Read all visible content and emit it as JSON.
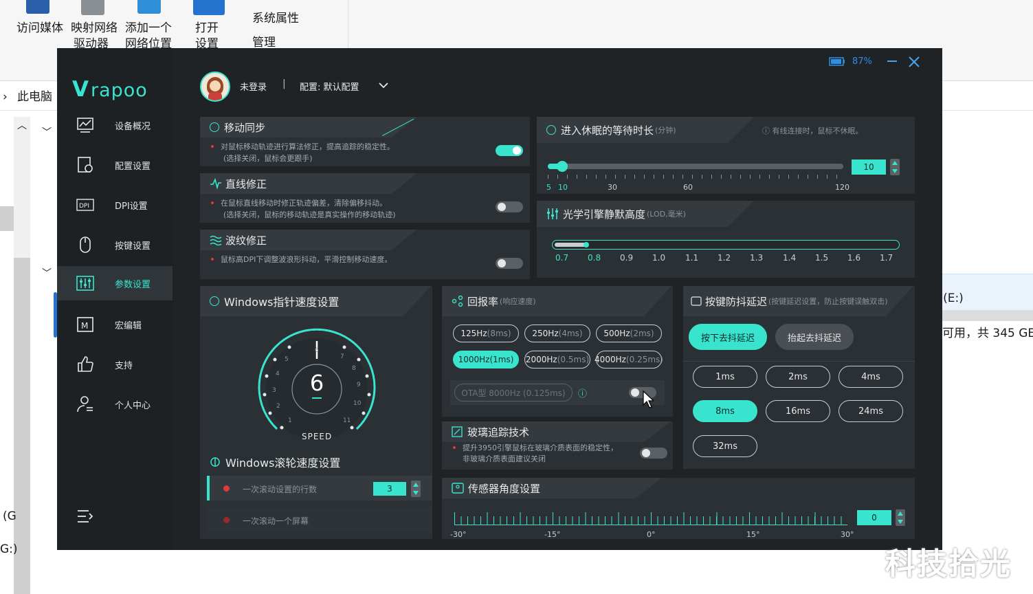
{
  "explorer": {
    "ribbon": [
      "访问媒体",
      "映射网络",
      "驱动器",
      "添加一个",
      "网络位置",
      "打开",
      "设置",
      "系统属性",
      "管理"
    ],
    "address": "此电脑",
    "drive_label": "t (E:)",
    "drive_space": "可用，共 345 GE",
    "left_labels": [
      "(G",
      "G:)"
    ]
  },
  "app": {
    "logo": "rapoo",
    "battery": "87%",
    "user": {
      "name": "未登录",
      "config": "配置: 默认配置"
    },
    "nav": [
      {
        "label": "设备概况",
        "icon": "device-overview-icon"
      },
      {
        "label": "配置设置",
        "icon": "config-icon"
      },
      {
        "label": "DPI设置",
        "icon": "dpi-icon"
      },
      {
        "label": "按键设置",
        "icon": "mouse-icon"
      },
      {
        "label": "参数设置",
        "icon": "sliders-icon",
        "active": true
      },
      {
        "label": "宏编辑",
        "icon": "macro-icon"
      },
      {
        "label": "支持",
        "icon": "thumbs-up-icon"
      },
      {
        "label": "个人中心",
        "icon": "user-icon"
      }
    ],
    "motion_sync": {
      "title": "移动同步",
      "desc1": "对鼠标移动轨迹进行算法修正，提高追踪的稳定性。",
      "desc2": "(选择关闭，鼠标会更跟手)",
      "on": true
    },
    "angle_snap": {
      "title": "直线修正",
      "desc1": "在鼠标直线移动时修正轨迹偏差，清除偏移抖动。",
      "desc2": "(选择关闭，鼠标的移动轨迹是真实操作的移动轨迹)",
      "on": false
    },
    "ripple": {
      "title": "波纹修正",
      "desc1": "鼠标高DPI下调整波浪形抖动，平滑控制移动速度。",
      "on": false
    },
    "sleep": {
      "title": "进入休眠的等待时长",
      "unit": "(分钟)",
      "note": "有线连接时，鼠标不休眠。",
      "value": "10",
      "ticks": [
        "5",
        "10",
        "30",
        "60",
        "120"
      ],
      "level": 0.1
    },
    "lod": {
      "title": "光学引擎静默高度",
      "unit": "(LOD,毫米)",
      "ticks": [
        "0.7",
        "0.8",
        "0.9",
        "1.0",
        "1.1",
        "1.2",
        "1.3",
        "1.4",
        "1.5",
        "1.6",
        "1.7"
      ],
      "selected": "0.8"
    },
    "pointer": {
      "title": "Windows指针速度设置",
      "value": "6",
      "label": "SPEED",
      "dial": [
        "1",
        "2",
        "3",
        "4",
        "5",
        "6",
        "7",
        "8",
        "9",
        "10",
        "11"
      ]
    },
    "scroll": {
      "title": "Windows滚轮速度设置",
      "row1": "一次滚动设置的行数",
      "row1_value": "3",
      "row2": "一次滚动一个屏幕"
    },
    "polling": {
      "title": "回报率",
      "unit": "(响应速度)",
      "rates": [
        {
          "hz": "125Hz",
          "ms": "(8ms)"
        },
        {
          "hz": "250Hz",
          "ms": "(4ms)"
        },
        {
          "hz": "500Hz",
          "ms": "(2ms)"
        },
        {
          "hz": "1000Hz",
          "ms": "(1ms)",
          "on": true
        },
        {
          "hz": "2000Hz",
          "ms": "(0.5ms)"
        },
        {
          "hz": "4000Hz",
          "ms": "(0.25ms)"
        }
      ],
      "ota": "OTA型 8000Hz (0.125ms)"
    },
    "glass": {
      "title": "玻璃追踪技术",
      "desc1": "提升3950引擎鼠标在玻璃介质表面的稳定性，",
      "desc2": "非玻璃介质表面建议关闭"
    },
    "sensor_angle": {
      "title": "传感器角度设置",
      "value": "0",
      "ticks": [
        "-30°",
        "-15°",
        "0°",
        "15°",
        "30°"
      ]
    },
    "debounce": {
      "title": "按键防抖延迟",
      "unit": "(按键延迟设置，防止按键误触双击)",
      "press": "按下去抖延迟",
      "release": "抬起去抖延迟",
      "values": [
        "1ms",
        "2ms",
        "4ms",
        "8ms",
        "16ms",
        "24ms",
        "32ms"
      ],
      "selected": "8ms"
    }
  },
  "watermark": "科技拾光"
}
